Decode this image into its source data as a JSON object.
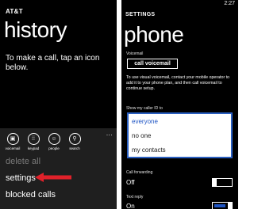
{
  "left": {
    "carrier": "AT&T",
    "title": "history",
    "instruction": "To make a call, tap an icon below.",
    "appbar": {
      "buttons": [
        {
          "label": "voicemail",
          "icon": "voicemail-icon",
          "glyph": "▣"
        },
        {
          "label": "keypad",
          "icon": "keypad-icon",
          "glyph": "⁞⁞"
        },
        {
          "label": "people",
          "icon": "people-icon",
          "glyph": "☺"
        },
        {
          "label": "search",
          "icon": "search-icon",
          "glyph": "⚲"
        }
      ],
      "more": "..."
    },
    "menu": [
      "delete all",
      "settings",
      "blocked calls"
    ]
  },
  "right": {
    "clock": "2:27",
    "section": "SETTINGS",
    "title": "phone",
    "voicemail_label": "Voicemail",
    "voicemail_button": "call voicemail",
    "voicemail_desc": "To use visual voicemail, contact your mobile operator to add it to your phone plan, and then call voicemail to continue setup.",
    "callerid_label": "Show my caller ID to",
    "callerid_options": [
      "everyone",
      "no one",
      "my contacts"
    ],
    "callerid_selected": "everyone",
    "forwarding_label": "Call forwarding",
    "forwarding_state": "Off",
    "textreply_label": "Text reply",
    "textreply_state": "On"
  },
  "colors": {
    "accent": "#1f55c4",
    "arrow": "#e0212a",
    "appbar": "#1f1f1f"
  }
}
